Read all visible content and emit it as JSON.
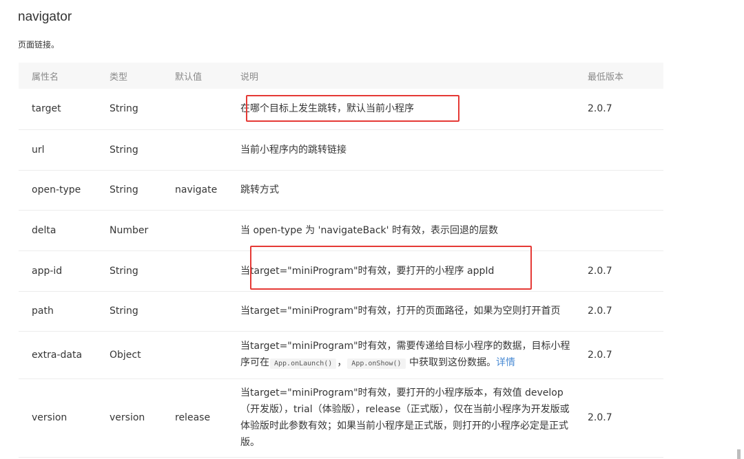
{
  "title": "navigator",
  "subtitle": "页面链接。",
  "columns": [
    "属性名",
    "类型",
    "默认值",
    "说明",
    "最低版本"
  ],
  "rows": [
    {
      "name": "target",
      "type": "String",
      "default": "",
      "desc": "在哪个目标上发生跳转，默认当前小程序",
      "version": "2.0.7"
    },
    {
      "name": "url",
      "type": "String",
      "default": "",
      "desc": "当前小程序内的跳转链接",
      "version": ""
    },
    {
      "name": "open-type",
      "type": "String",
      "default": "navigate",
      "desc": "跳转方式",
      "version": ""
    },
    {
      "name": "delta",
      "type": "Number",
      "default": "",
      "desc": "当 open-type 为 'navigateBack' 时有效，表示回退的层数",
      "version": ""
    },
    {
      "name": "app-id",
      "type": "String",
      "default": "",
      "desc": "当target=\"miniProgram\"时有效，要打开的小程序 appId",
      "version": "2.0.7"
    },
    {
      "name": "path",
      "type": "String",
      "default": "",
      "desc": "当target=\"miniProgram\"时有效，打开的页面路径，如果为空则打开首页",
      "version": "2.0.7"
    },
    {
      "name": "extra-data",
      "type": "Object",
      "default": "",
      "desc_parts": {
        "text1": "当target=\"miniProgram\"时有效，需要传递给目标小程序的数据，目标小程序可在",
        "code1": "App.onLaunch()",
        "sep": "，",
        "code2": "App.onShow()",
        "text2": "中获取到这份数据。",
        "link": "详情"
      },
      "version": "2.0.7"
    },
    {
      "name": "version",
      "type": "version",
      "default": "release",
      "desc": "当target=\"miniProgram\"时有效，要打开的小程序版本，有效值 develop（开发版），trial（体验版），release（正式版），仅在当前小程序为开发版或体验版时此参数有效；如果当前小程序是正式版，则打开的小程序必定是正式版。",
      "version": "2.0.7"
    }
  ],
  "highlight_color": "#e53935",
  "link_color": "#4a8bd4"
}
